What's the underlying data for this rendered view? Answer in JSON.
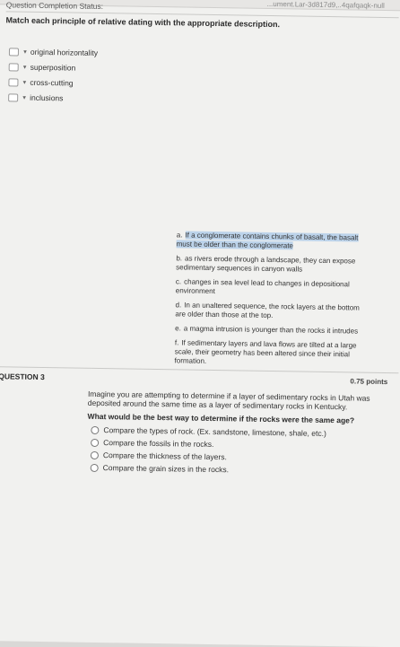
{
  "page": {
    "url_fragment": "...ument.Lar-3d817d9,..4qafqaqk-null",
    "status": "Question Completion Status:"
  },
  "match_question": {
    "title": "Match each principle of relative dating with the appropriate description.",
    "items": [
      {
        "label": "original horizontality"
      },
      {
        "label": "superposition"
      },
      {
        "label": "cross-cutting"
      },
      {
        "label": "inclusions"
      }
    ],
    "answers": [
      {
        "letter": "a.",
        "text": "If a conglomerate contains chunks of basalt, the basalt must be older than the conglomerate"
      },
      {
        "letter": "b.",
        "text": "as rivers erode through a landscape, they can expose sedimentary sequences in canyon walls"
      },
      {
        "letter": "c.",
        "text": "changes in sea level lead to changes in depositional environment"
      },
      {
        "letter": "d.",
        "text": "In an unaltered sequence, the rock layers at the bottom are older than those at the top."
      },
      {
        "letter": "e.",
        "text": "a magma intrusion is younger than the rocks it intrudes"
      },
      {
        "letter": "f.",
        "text": "If sedimentary layers and lava flows are tilted at a large scale, their geometry has been altered since their initial formation."
      }
    ]
  },
  "question3": {
    "heading": "QUESTION 3",
    "points": "0.75 points",
    "prompt": "Imagine you are attempting to determine if a layer of sedimentary rocks in Utah was deposited around the same time as a layer of sedimentary rocks in Kentucky.",
    "ask": "What would be the best way to determine if the rocks were the same age?",
    "options": [
      {
        "label": "Compare the types of rock. (Ex. sandstone, limestone, shale, etc.)"
      },
      {
        "label": "Compare the fossils in the rocks."
      },
      {
        "label": "Compare the thickness of the layers."
      },
      {
        "label": "Compare the grain sizes in the rocks."
      }
    ]
  }
}
